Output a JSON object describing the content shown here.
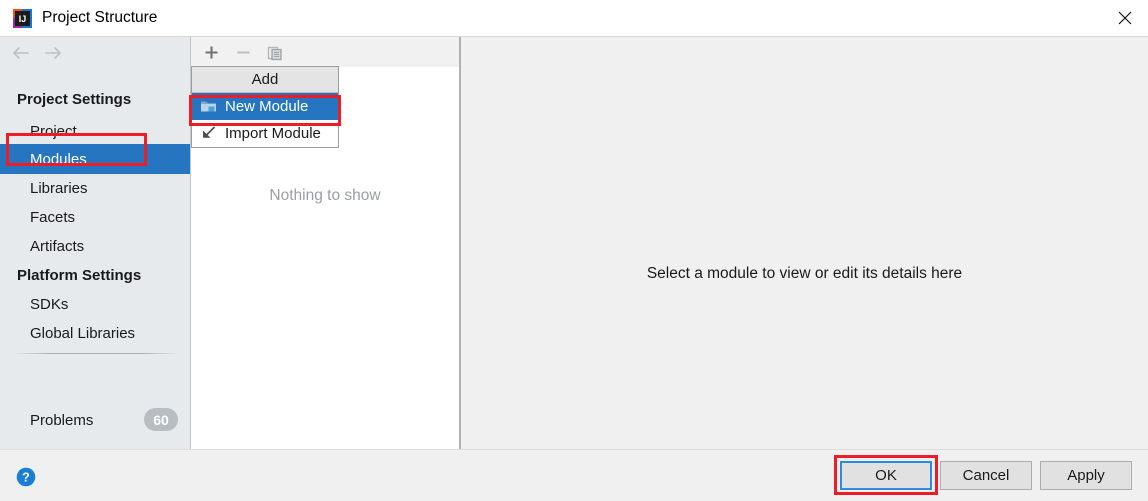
{
  "window": {
    "title": "Project Structure",
    "logo_icon": "intellij-idea-logo",
    "close_icon": "close-icon"
  },
  "sidebar": {
    "nav": {
      "back_icon": "arrow-left-icon",
      "forward_icon": "arrow-right-icon"
    },
    "groups": [
      {
        "label": "Project Settings",
        "items": [
          {
            "label": "Project",
            "selected": false
          },
          {
            "label": "Modules",
            "selected": true
          },
          {
            "label": "Libraries",
            "selected": false
          },
          {
            "label": "Facets",
            "selected": false
          },
          {
            "label": "Artifacts",
            "selected": false
          }
        ]
      },
      {
        "label": "Platform Settings",
        "items": [
          {
            "label": "SDKs",
            "selected": false
          },
          {
            "label": "Global Libraries",
            "selected": false
          }
        ]
      }
    ],
    "problems": {
      "label": "Problems",
      "count": "60"
    }
  },
  "middle_panel": {
    "toolbar": {
      "add_icon": "plus-icon",
      "remove_icon": "minus-icon",
      "copy_icon": "copy-icon"
    },
    "empty_message": "Nothing to show"
  },
  "add_menu": {
    "header": "Add",
    "items": [
      {
        "label": "New Module",
        "icon": "new-folder-icon",
        "highlighted": true
      },
      {
        "label": "Import Module",
        "icon": "import-arrow-icon",
        "highlighted": false
      }
    ]
  },
  "right_panel": {
    "message": "Select a module to view or edit its details here"
  },
  "bottom_bar": {
    "help_icon": "help-question-icon",
    "buttons": {
      "ok": "OK",
      "cancel": "Cancel",
      "apply": "Apply"
    }
  },
  "annotations": {
    "color": "#ee1c25",
    "targets": [
      "Modules",
      "New Module",
      "OK"
    ]
  },
  "colors": {
    "accent_blue": "#2575c0",
    "annotation_red": "#ee1c25",
    "sidebar_bg": "#e6eaed",
    "panel_bg": "#f0f0f0",
    "badge_gray": "#b8bdc2"
  }
}
